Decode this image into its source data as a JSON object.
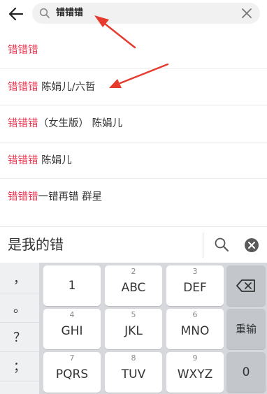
{
  "search": {
    "query": "错错错"
  },
  "suggestions": [
    {
      "highlight": "错错错",
      "rest": ""
    },
    {
      "highlight": "错错错",
      "rest": " 陈娟儿/六哲"
    },
    {
      "highlight": "错错错",
      "rest": "（女生版） 陈娟儿"
    },
    {
      "highlight": "错错错",
      "rest": " 陈娟儿"
    },
    {
      "highlight": "错错错",
      "rest": "一错再错 群星"
    }
  ],
  "ime": {
    "candidate": "是我的错"
  },
  "keyboard": {
    "punctuation": [
      "，",
      "。",
      "？",
      "；"
    ],
    "keys": {
      "k1": {
        "num": "",
        "label": "1"
      },
      "k2": {
        "num": "2",
        "label": "ABC"
      },
      "k3": {
        "num": "3",
        "label": "DEF"
      },
      "k4": {
        "num": "4",
        "label": "GHI"
      },
      "k5": {
        "num": "5",
        "label": "JKL"
      },
      "k6": {
        "num": "6",
        "label": "MNO"
      },
      "k7": {
        "num": "7",
        "label": "PQRS"
      },
      "k8": {
        "num": "8",
        "label": "TUV"
      },
      "k9": {
        "num": "9",
        "label": "WXYZ"
      },
      "k0": {
        "num": "",
        "label": "0"
      }
    },
    "retype_label": "重输"
  },
  "colors": {
    "highlight": "#e8344e",
    "annotation_arrow": "#e53a2c"
  },
  "icons": [
    "back-arrow-icon",
    "search-icon",
    "clear-icon",
    "candidate-search-icon",
    "candidate-close-icon",
    "backspace-icon"
  ]
}
